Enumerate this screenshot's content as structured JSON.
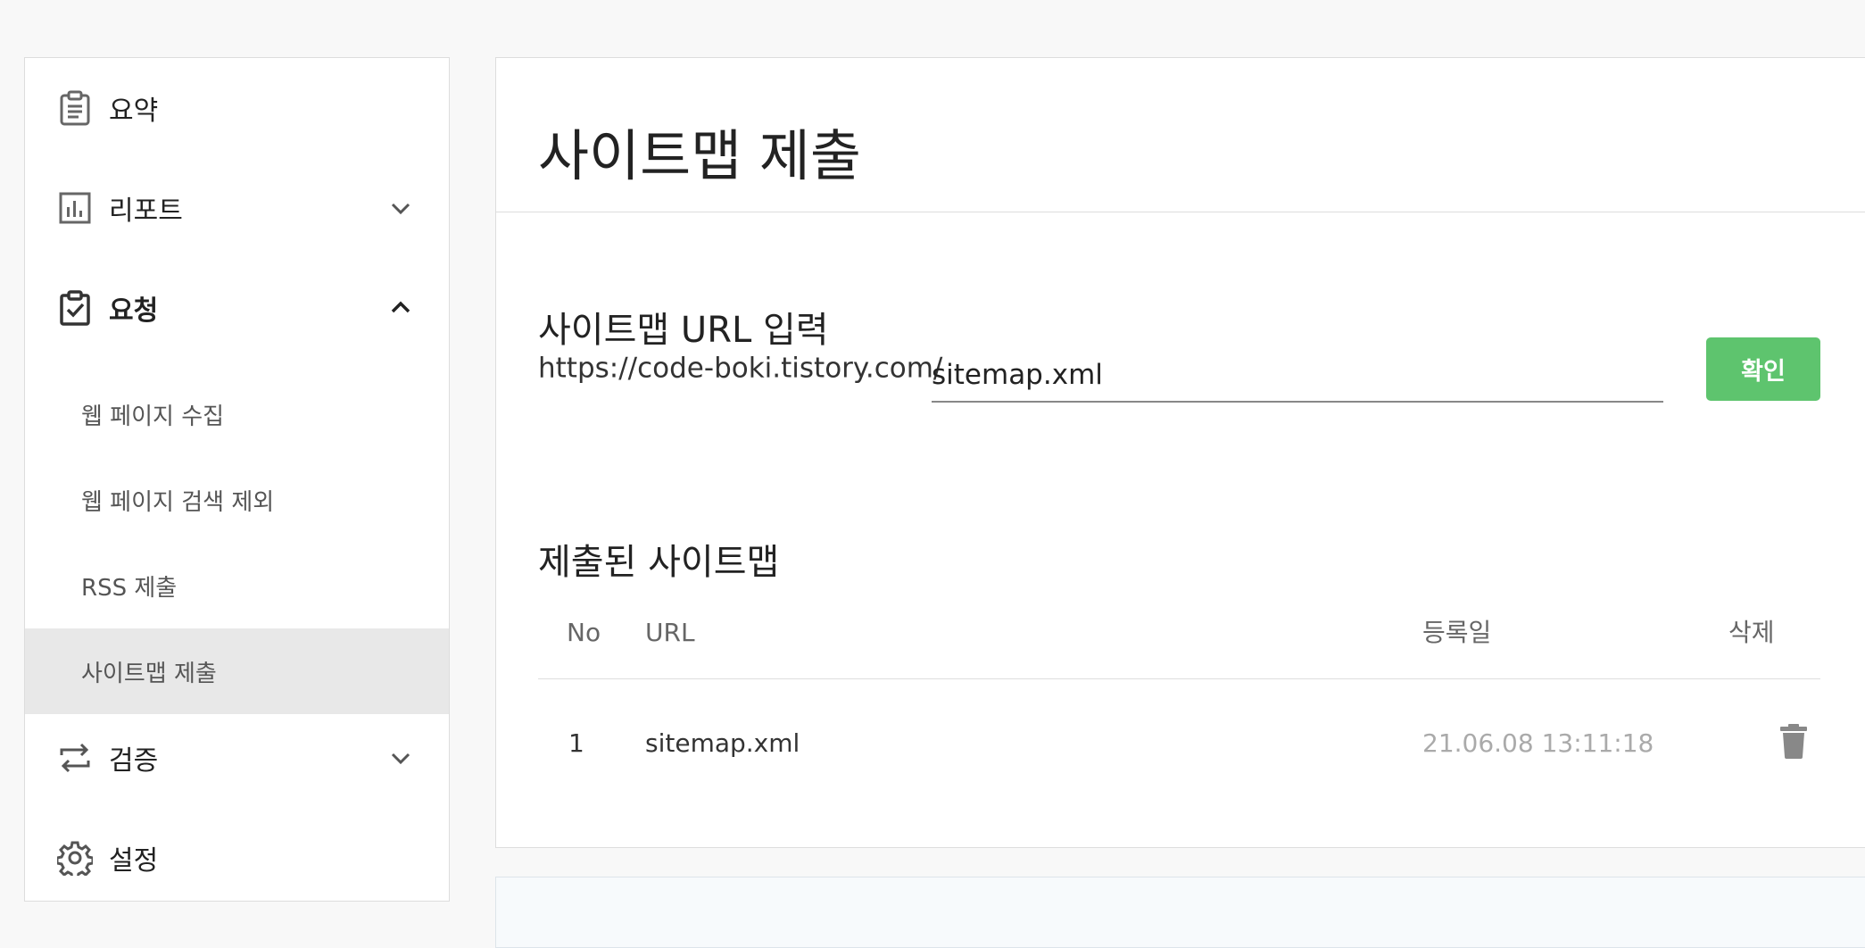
{
  "sidebar": {
    "summary": {
      "label": "요약",
      "icon": "clipboard-list-icon"
    },
    "reports": {
      "label": "리포트",
      "icon": "bar-chart-icon"
    },
    "requests": {
      "label": "요청",
      "icon": "clipboard-check-icon",
      "sub_items": [
        {
          "label": "웹 페이지 수집"
        },
        {
          "label": "웹 페이지 검색 제외"
        },
        {
          "label": "RSS 제출"
        },
        {
          "label": "사이트맵 제출",
          "active": true
        }
      ]
    },
    "verification": {
      "label": "검증",
      "icon": "repeat-icon"
    },
    "settings": {
      "label": "설정",
      "icon": "gear-icon"
    }
  },
  "main": {
    "title": "사이트맵 제출",
    "url_section": {
      "title": "사이트맵 URL 입력",
      "prefix": "https://code-boki.tistory.com/",
      "input_value": "sitemap.xml",
      "confirm_label": "확인"
    },
    "submitted_section": {
      "title": "제출된 사이트맵",
      "columns": {
        "no": "No",
        "url": "URL",
        "date": "등록일",
        "delete": "삭제"
      },
      "rows": [
        {
          "no": "1",
          "url": "sitemap.xml",
          "date": "21.06.08 13:11:18",
          "delete_icon": "trash-icon"
        }
      ]
    }
  },
  "colors": {
    "accent": "#5ec46e",
    "active_bg": "#e8e8e8",
    "icon_gray": "#666666"
  }
}
